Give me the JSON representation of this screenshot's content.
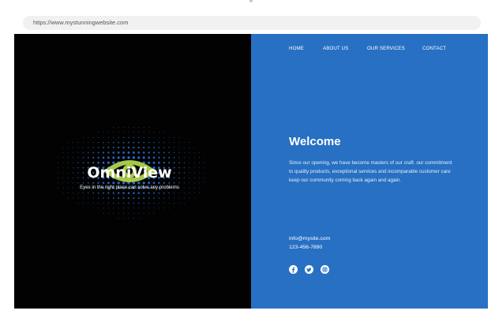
{
  "browser": {
    "url": "https://www.mystunningwebsite.com"
  },
  "logo": {
    "name": "OmniView",
    "tagline": "Eyes in the right place can solve any problems"
  },
  "nav": {
    "items": [
      {
        "label": "HOME"
      },
      {
        "label": "ABOUT US"
      },
      {
        "label": "OUR SERVICES"
      },
      {
        "label": "CONTACT"
      }
    ]
  },
  "hero": {
    "heading": "Welcome",
    "body": "Since our opening, we have become masters of our craft. our commitment to quality products, exceptional services and incomparable customer care keep our community coming back again and again."
  },
  "contact": {
    "email": "info@mysite.com",
    "phone": "123-456-7890"
  },
  "social": [
    "facebook-icon",
    "twitter-icon",
    "instagram-icon"
  ],
  "colors": {
    "left_background": "#020202",
    "right_background": "#2770c3",
    "dot_color": "#2f79e0",
    "eye_color": "#a6c94a"
  }
}
